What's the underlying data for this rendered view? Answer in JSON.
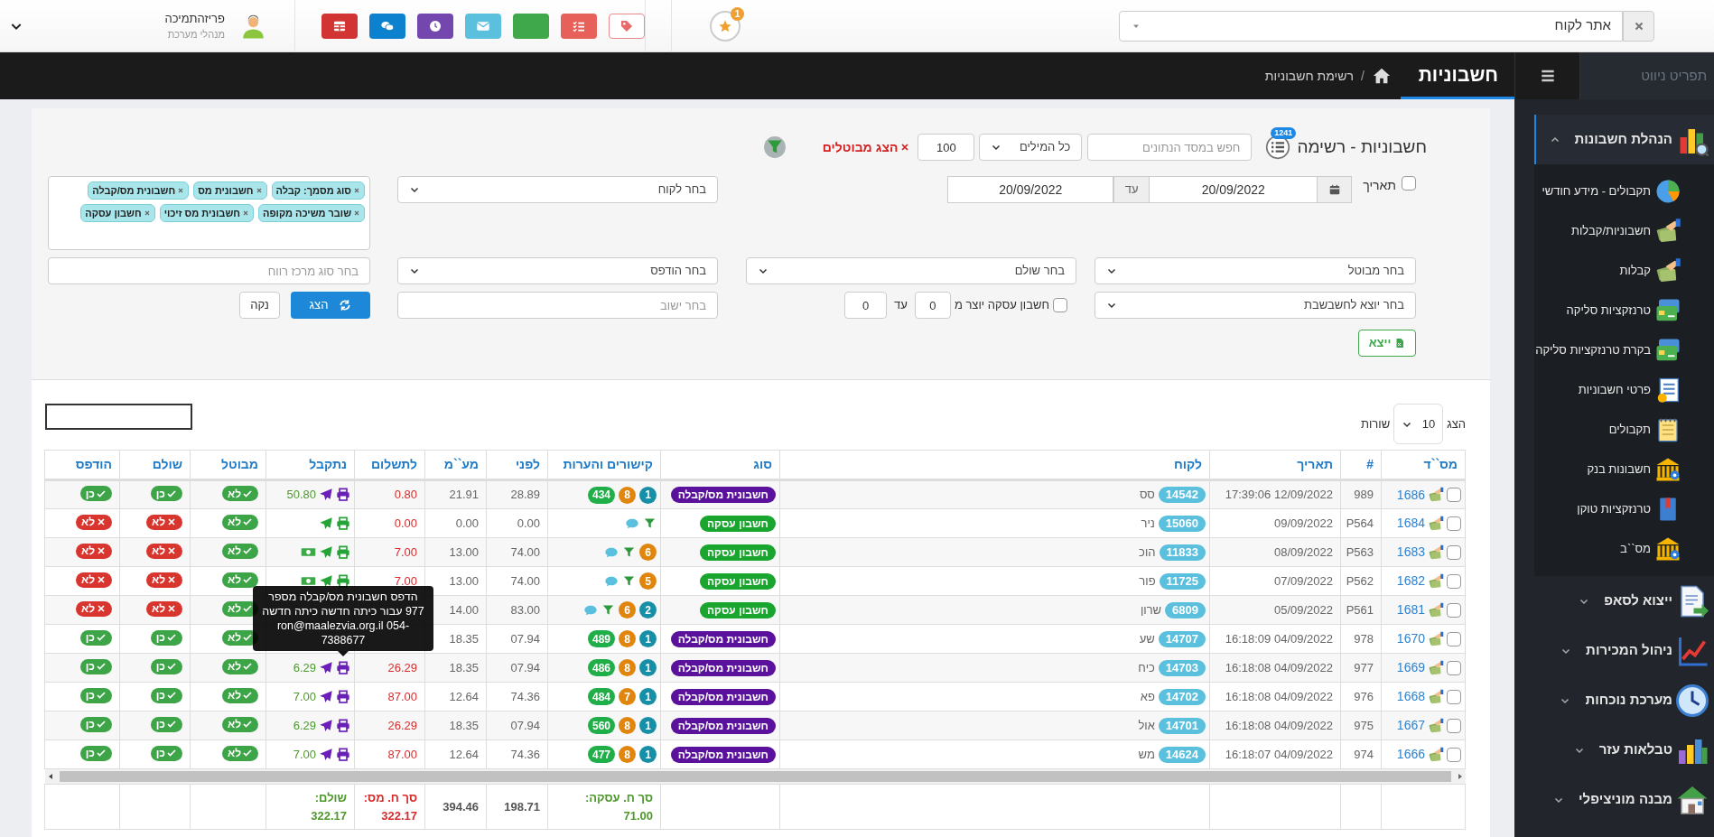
{
  "topbar": {
    "customer_search": {
      "placeholder": "אתר לקוח"
    },
    "notifications": {
      "badge": "1"
    },
    "toolbar_buttons": [
      {
        "kind": "tag"
      },
      {
        "kind": "checklist"
      },
      {
        "kind": "blank"
      },
      {
        "kind": "mail"
      },
      {
        "kind": "clock"
      },
      {
        "kind": "chat"
      },
      {
        "kind": "table"
      }
    ],
    "user": {
      "name": "פריזהתמיכה",
      "role": "מנהלי מערכת"
    }
  },
  "navbar": {
    "menu_label": "תפריט ניווט",
    "page_title": "חשבוניות",
    "breadcrumb_separator": "/",
    "breadcrumb": "רשימת חשבוניות"
  },
  "sidebar": {
    "sections": [
      {
        "label": "הנהלת חשבונות",
        "kind": "chart-search",
        "expanded": true,
        "children": [
          {
            "label": "תקבולים - מידע חודשי",
            "kind": "pie"
          },
          {
            "label": "חשבוניות/קבלות",
            "kind": "money-hand"
          },
          {
            "label": "קבלות",
            "kind": "money-hand"
          },
          {
            "label": "טרנזקציות סליקה",
            "kind": "card"
          },
          {
            "label": "בקרת טרנזקציות סליקה",
            "kind": "card"
          },
          {
            "label": "פרטי חשבוניות",
            "kind": "invoice"
          },
          {
            "label": "תקבולים",
            "kind": "notepad"
          },
          {
            "label": "חשבונות בנק",
            "kind": "bank"
          },
          {
            "label": "טרנזקציות טוקן",
            "kind": "book"
          },
          {
            "label": "מס``ב",
            "kind": "bank"
          }
        ]
      },
      {
        "label": "ייצוא לסאפ",
        "kind": "document",
        "expanded": false
      },
      {
        "label": "ניהול המכירות",
        "kind": "line-chart",
        "expanded": false
      },
      {
        "label": "מערכת נוכחות",
        "kind": "clock",
        "expanded": false
      },
      {
        "label": "טבלאות עזר",
        "kind": "bars",
        "expanded": false
      },
      {
        "label": "מבנה מוניציפלי",
        "kind": "house",
        "expanded": false
      }
    ]
  },
  "filters": {
    "title": "חשבוניות - רשימה",
    "count_badge": "1241",
    "search": {
      "placeholder": "חפש במסד הנתונים"
    },
    "match_select": "כל המילים",
    "limit": "100",
    "show_cancelled": "הצג מבוטלים",
    "date": {
      "label": "תאריך",
      "checked": false,
      "from": "20/09/2022",
      "to_label": "עד",
      "to": "20/09/2022"
    },
    "customer_select": {
      "placeholder": "בחר לקוח"
    },
    "tags": [
      "סוג מסמך: קבלה",
      "חשבונית מס",
      "חשבונית מס/קבלה",
      "שובר משיכה מקופה",
      "חשבונית מס זיכוי",
      "חשבון עסקה"
    ],
    "cancelled_select": {
      "placeholder": "בחר מבוטל"
    },
    "paid_select": {
      "placeholder": "בחר שולם"
    },
    "printed_select": {
      "placeholder": "בחר הודפס"
    },
    "profit_center": {
      "placeholder": "בחר סוג מרכז רווח"
    },
    "export_select": {
      "placeholder": "בחר יוצא לחשבשבת"
    },
    "deal_range": {
      "label": "חשבון עסקה יוצר מ",
      "checked": false,
      "from": "0",
      "to_label": "עד",
      "to": "0"
    },
    "settlement": {
      "placeholder": "בחר ישוב"
    },
    "show_button": "הצג",
    "clear_button": "נקה",
    "export_button": "ייצא"
  },
  "table": {
    "page_size": {
      "before": "הצג",
      "value": "10",
      "after": "שורות"
    },
    "columns": [
      "מס``ד",
      "#",
      "תאריך",
      "לקוח",
      "סוג",
      "קישורים והערות",
      "לפני",
      "מע``מ",
      "לתשלום",
      "נתקבל",
      "מבוטל",
      "שולם",
      "הודפס"
    ],
    "rows": [
      {
        "checked": false,
        "serial": "1686",
        "number": "989",
        "date": "17:39:06 12/09/2022",
        "customer_id": "14542",
        "customer_name": "סס",
        "type": {
          "label": "חשבונית מס/קבלה",
          "color": "#5a119c"
        },
        "links": [
          {
            "kind": "count",
            "text": "1",
            "color": "#178fa6"
          },
          {
            "kind": "count",
            "text": "8",
            "color": "#e0860f"
          },
          {
            "kind": "count",
            "text": "434",
            "color": "#1fae47"
          }
        ],
        "before": "28.89",
        "vat": "21.91",
        "to_pay": "0.80",
        "received": {
          "color": "#6a1fb8",
          "money": false,
          "amount": "50.80"
        },
        "cancelled": {
          "label": "לא",
          "ok": true
        },
        "paid": {
          "label": "כן",
          "ok": true
        },
        "printed": {
          "label": "כן",
          "ok": true
        }
      },
      {
        "checked": false,
        "serial": "1684",
        "number": "P564",
        "date": "09/09/2022",
        "customer_id": "15060",
        "customer_name": "ניר",
        "type": {
          "label": "חשבון עסקה",
          "color": "#1aa52f"
        },
        "links": [
          {
            "kind": "filter"
          },
          {
            "kind": "comment"
          }
        ],
        "before": "0.00",
        "vat": "0.00",
        "to_pay": "0.00",
        "received": {
          "color": "#22a534",
          "money": false
        },
        "cancelled": {
          "label": "לא",
          "ok": true
        },
        "paid": {
          "label": "לא",
          "ok": false
        },
        "printed": {
          "label": "לא",
          "ok": false
        }
      },
      {
        "checked": false,
        "serial": "1683",
        "number": "P563",
        "date": "08/09/2022",
        "customer_id": "11833",
        "customer_name": "הוכ",
        "type": {
          "label": "חשבון עסקה",
          "color": "#1aa52f"
        },
        "links": [
          {
            "kind": "count",
            "text": "6",
            "color": "#e0860f"
          },
          {
            "kind": "filter"
          },
          {
            "kind": "comment"
          }
        ],
        "before": "74.00",
        "vat": "13.00",
        "to_pay": "7.00",
        "received": {
          "color": "#22a534",
          "money": true
        },
        "cancelled": {
          "label": "לא",
          "ok": true
        },
        "paid": {
          "label": "לא",
          "ok": false
        },
        "printed": {
          "label": "לא",
          "ok": false
        }
      },
      {
        "checked": false,
        "serial": "1682",
        "number": "P562",
        "date": "07/09/2022",
        "customer_id": "11725",
        "customer_name": "פור",
        "type": {
          "label": "חשבון עסקה",
          "color": "#1aa52f"
        },
        "links": [
          {
            "kind": "count",
            "text": "5",
            "color": "#e0860f"
          },
          {
            "kind": "filter"
          },
          {
            "kind": "comment"
          }
        ],
        "before": "74.00",
        "vat": "13.00",
        "to_pay": "7.00",
        "received": {
          "color": "#22a534",
          "money": true
        },
        "cancelled": {
          "label": "לא",
          "ok": true
        },
        "paid": {
          "label": "לא",
          "ok": false
        },
        "printed": {
          "label": "לא",
          "ok": false
        }
      },
      {
        "checked": false,
        "serial": "1681",
        "number": "P561",
        "date": "05/09/2022",
        "customer_id": "6809",
        "customer_name": "שרון",
        "type": {
          "label": "חשבון עסקה",
          "color": "#1aa52f"
        },
        "links": [
          {
            "kind": "count",
            "text": "2",
            "color": "#178fa6"
          },
          {
            "kind": "count",
            "text": "6",
            "color": "#e0860f"
          },
          {
            "kind": "filter"
          },
          {
            "kind": "comment"
          }
        ],
        "before": "83.00",
        "vat": "14.00",
        "cancelled": {
          "label": "לא",
          "ok": true
        },
        "paid": {
          "label": "לא",
          "ok": false
        },
        "printed": {
          "label": "לא",
          "ok": false
        }
      },
      {
        "checked": false,
        "serial": "1670",
        "number": "978",
        "date": "16:18:09 04/09/2022",
        "customer_id": "14707",
        "customer_name": "שע",
        "type": {
          "label": "חשבונית מס/קבלה",
          "color": "#5a119c"
        },
        "links": [
          {
            "kind": "count",
            "text": "1",
            "color": "#178fa6"
          },
          {
            "kind": "count",
            "text": "8",
            "color": "#e0860f"
          },
          {
            "kind": "count",
            "text": "489",
            "color": "#1fae47"
          }
        ],
        "before": "07.94",
        "vat": "18.35",
        "cancelled": {
          "label": "לא",
          "ok": true
        },
        "paid": {
          "label": "כן",
          "ok": true
        },
        "printed": {
          "label": "כן",
          "ok": true
        }
      },
      {
        "checked": false,
        "serial": "1669",
        "number": "977",
        "date": "16:18:08 04/09/2022",
        "customer_id": "14703",
        "customer_name": "כיח",
        "type": {
          "label": "חשבונית מס/קבלה",
          "color": "#5a119c"
        },
        "links": [
          {
            "kind": "count",
            "text": "1",
            "color": "#178fa6"
          },
          {
            "kind": "count",
            "text": "8",
            "color": "#e0860f"
          },
          {
            "kind": "count",
            "text": "486",
            "color": "#1fae47"
          }
        ],
        "before": "07.94",
        "vat": "18.35",
        "to_pay": "26.29",
        "received": {
          "color": "#6a1fb8",
          "money": false,
          "amount": "6.29"
        },
        "cancelled": {
          "label": "לא",
          "ok": true
        },
        "paid": {
          "label": "כן",
          "ok": true
        },
        "printed": {
          "label": "כן",
          "ok": true
        }
      },
      {
        "checked": false,
        "serial": "1668",
        "number": "976",
        "date": "16:18:08 04/09/2022",
        "customer_id": "14702",
        "customer_name": "פא",
        "type": {
          "label": "חשבונית מס/קבלה",
          "color": "#5a119c"
        },
        "links": [
          {
            "kind": "count",
            "text": "1",
            "color": "#178fa6"
          },
          {
            "kind": "count",
            "text": "7",
            "color": "#e0860f"
          },
          {
            "kind": "count",
            "text": "484",
            "color": "#1fae47"
          }
        ],
        "before": "74.36",
        "vat": "12.64",
        "to_pay": "87.00",
        "received": {
          "color": "#6a1fb8",
          "money": false,
          "amount": "7.00"
        },
        "cancelled": {
          "label": "לא",
          "ok": true
        },
        "paid": {
          "label": "כן",
          "ok": true
        },
        "printed": {
          "label": "כן",
          "ok": true
        }
      },
      {
        "checked": false,
        "serial": "1667",
        "number": "975",
        "date": "16:18:08 04/09/2022",
        "customer_id": "14701",
        "customer_name": "אול",
        "type": {
          "label": "חשבונית מס/קבלה",
          "color": "#5a119c"
        },
        "links": [
          {
            "kind": "count",
            "text": "1",
            "color": "#178fa6"
          },
          {
            "kind": "count",
            "text": "8",
            "color": "#e0860f"
          },
          {
            "kind": "count",
            "text": "560",
            "color": "#1fae47"
          }
        ],
        "before": "07.94",
        "vat": "18.35",
        "to_pay": "26.29",
        "received": {
          "color": "#6a1fb8",
          "money": false,
          "amount": "6.29"
        },
        "cancelled": {
          "label": "לא",
          "ok": true
        },
        "paid": {
          "label": "כן",
          "ok": true
        },
        "printed": {
          "label": "כן",
          "ok": true
        }
      },
      {
        "checked": false,
        "serial": "1666",
        "number": "974",
        "date": "16:18:07 04/09/2022",
        "customer_id": "14624",
        "customer_name": "מש",
        "type": {
          "label": "חשבונית מס/קבלה",
          "color": "#5a119c"
        },
        "links": [
          {
            "kind": "count",
            "text": "1",
            "color": "#178fa6"
          },
          {
            "kind": "count",
            "text": "8",
            "color": "#e0860f"
          },
          {
            "kind": "count",
            "text": "477",
            "color": "#1fae47"
          }
        ],
        "before": "74.36",
        "vat": "12.64",
        "to_pay": "87.00",
        "received": {
          "color": "#6a1fb8",
          "money": false,
          "amount": "7.00"
        },
        "cancelled": {
          "label": "לא",
          "ok": true
        },
        "paid": {
          "label": "כן",
          "ok": true
        },
        "printed": {
          "label": "כן",
          "ok": true
        }
      }
    ],
    "footer": {
      "deal_total": {
        "label": "סך ח. עסקה:",
        "value": "71.00"
      },
      "before": "198.71",
      "vat": "394.46",
      "tax_total": {
        "label": "סך ח. מס:",
        "value": "322.17"
      },
      "paid_total": {
        "label": "שולם:",
        "value": "322.17"
      }
    },
    "tooltip": "הדפס חשבונית מס/קבלה מספר 977 עבור כיתה חדשה כיתה חדשה ron@maalezvia.org.il 054-7388677"
  }
}
